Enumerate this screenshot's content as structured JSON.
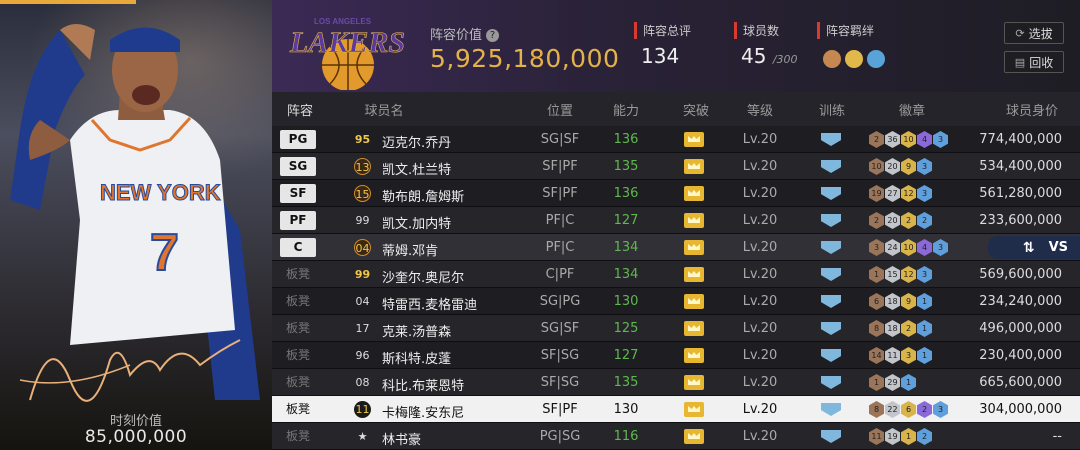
{
  "card": {
    "value_label": "时刻价值",
    "value": "85,000,000",
    "jersey_text": "NEW YORK",
    "jersey_number": "7"
  },
  "header": {
    "logo_text": "LAKERS",
    "logo_subtext": "LOS ANGELES",
    "value_label": "阵容价值",
    "value_help": "?",
    "team_value": "5,925,180,000",
    "overall_label": "阵容总评",
    "overall": "134",
    "count_label": "球员数",
    "count": "45",
    "count_max": "/300",
    "bonds_label": "阵容羁绊",
    "filter_button": "选拔",
    "back_button": "回收"
  },
  "columns": {
    "lineup": "阵容",
    "name": "球员名",
    "position": "位置",
    "rating": "能力",
    "breakthrough": "突破",
    "level": "等级",
    "training": "训练",
    "badges": "徽章",
    "value": "球员身价"
  },
  "rows": [
    {
      "slot": "PG",
      "num": "95",
      "name": "迈克尔.乔丹",
      "pos": "SG|SF",
      "rating": "136",
      "level": "Lv.20",
      "badges": [
        "2",
        "36",
        "10",
        "4",
        "3"
      ],
      "value": "774,400,000"
    },
    {
      "slot": "SG",
      "num": "13",
      "name": "凯文.杜兰特",
      "pos": "SF|PF",
      "rating": "135",
      "level": "Lv.20",
      "badges": [
        "10",
        "20",
        "9",
        "3"
      ],
      "value": "534,400,000"
    },
    {
      "slot": "SF",
      "num": "15",
      "name": "勒布朗.詹姆斯",
      "pos": "SF|PF",
      "rating": "136",
      "level": "Lv.20",
      "badges": [
        "19",
        "27",
        "12",
        "3"
      ],
      "value": "561,280,000"
    },
    {
      "slot": "PF",
      "num": "99",
      "name": "凯文.加内特",
      "pos": "PF|C",
      "rating": "127",
      "level": "Lv.20",
      "badges": [
        "2",
        "20",
        "2",
        "2"
      ],
      "value": "233,600,000"
    },
    {
      "slot": "C",
      "num": "04",
      "name": "蒂姆.邓肯",
      "pos": "PF|C",
      "rating": "134",
      "level": "Lv.20",
      "badges": [
        "3",
        "24",
        "10",
        "4",
        "3"
      ],
      "value": "",
      "vs": "VS"
    },
    {
      "slot": "板凳",
      "num": "99",
      "name": "沙奎尔.奥尼尔",
      "pos": "C|PF",
      "rating": "134",
      "level": "Lv.20",
      "badges": [
        "1",
        "15",
        "12",
        "3"
      ],
      "value": "569,600,000"
    },
    {
      "slot": "板凳",
      "num": "04",
      "name": "特雷西.麦格雷迪",
      "pos": "SG|PG",
      "rating": "130",
      "level": "Lv.20",
      "badges": [
        "6",
        "18",
        "9",
        "1"
      ],
      "value": "234,240,000"
    },
    {
      "slot": "板凳",
      "num": "17",
      "name": "克莱.汤普森",
      "pos": "SG|SF",
      "rating": "125",
      "level": "Lv.20",
      "badges": [
        "8",
        "18",
        "2",
        "1"
      ],
      "value": "496,000,000"
    },
    {
      "slot": "板凳",
      "num": "96",
      "name": "斯科特.皮蓬",
      "pos": "SF|SG",
      "rating": "127",
      "level": "Lv.20",
      "badges": [
        "14",
        "11",
        "3",
        "1"
      ],
      "value": "230,400,000"
    },
    {
      "slot": "板凳",
      "num": "08",
      "name": "科比.布莱恩特",
      "pos": "SF|SG",
      "rating": "135",
      "level": "Lv.20",
      "badges": [
        "1",
        "29",
        "1"
      ],
      "value": "665,600,000"
    },
    {
      "slot": "板凳",
      "num": "11",
      "name": "卡梅隆.安东尼",
      "pos": "SF|PF",
      "rating": "130",
      "level": "Lv.20",
      "badges": [
        "8",
        "22",
        "6",
        "2",
        "3"
      ],
      "value": "304,000,000"
    },
    {
      "slot": "板凳",
      "num": "★",
      "name": "林书豪",
      "pos": "PG|SG",
      "rating": "116",
      "level": "Lv.20",
      "badges": [
        "11",
        "19",
        "1",
        "2"
      ],
      "value": "--"
    }
  ],
  "colors": {
    "accent_gold": "#e3b24a",
    "rating_green": "#5fb84e",
    "red_marker": "#d93a2f"
  }
}
